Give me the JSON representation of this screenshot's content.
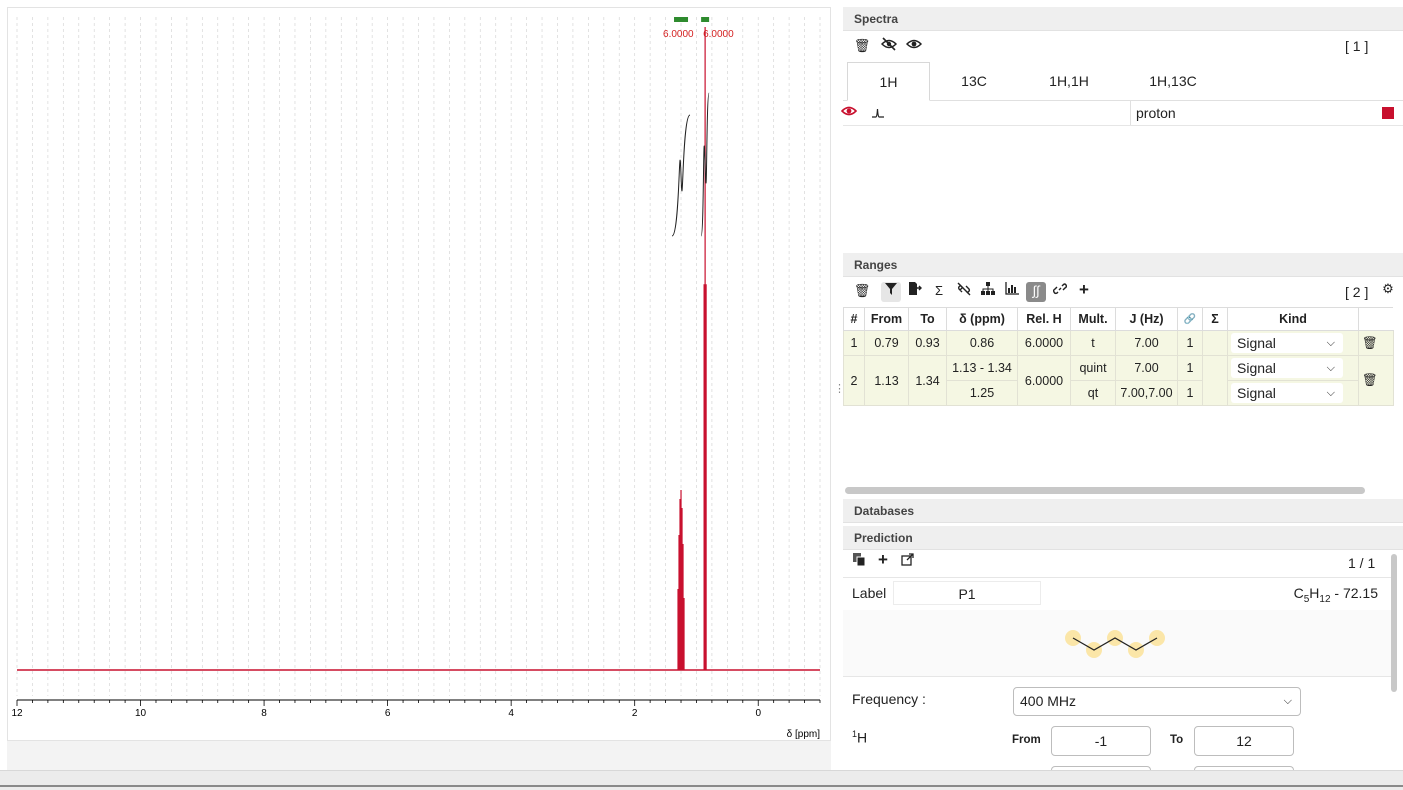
{
  "colors": {
    "spectrum": "#c8102e",
    "integral": "#222222",
    "range_marker": "#2e8b2e",
    "range_label": "#d42222",
    "row_bg": "#f5f7e3"
  },
  "chart_data": {
    "type": "line",
    "xlabel": "δ [ppm]",
    "xlim": [
      12,
      -1
    ],
    "x_ticks": [
      "12",
      "10",
      "8",
      "6",
      "4",
      "2",
      "0"
    ],
    "x_tick_values": [
      12,
      10,
      8,
      6,
      4,
      2,
      0
    ],
    "peaks": [
      {
        "ppm": 1.25,
        "height": 0.28
      },
      {
        "ppm": 0.86,
        "height": 1.0
      }
    ],
    "integral_labels": [
      "6.0000",
      "6.0000"
    ],
    "grid": "vertical dashed"
  },
  "spectra": {
    "title": "Spectra",
    "count": "[ 1 ]",
    "icons": [
      "trash-icon",
      "hide-all-icon",
      "show-all-icon"
    ],
    "tabs": [
      {
        "label": "1H",
        "active": true
      },
      {
        "label": "13C",
        "active": false
      },
      {
        "label": "1H,1H",
        "active": false
      },
      {
        "label": "1H,13C",
        "active": false
      }
    ],
    "row": {
      "name": "proton",
      "color": "#c8102e"
    }
  },
  "ranges": {
    "title": "Ranges",
    "count": "[ 2 ]",
    "columns": [
      "#",
      "From",
      "To",
      "δ (ppm)",
      "Rel. H",
      "Mult.",
      "J (Hz)",
      "🔗",
      "Σ",
      "Kind"
    ],
    "rows": [
      {
        "index": "1",
        "from": "0.79",
        "to": "0.93",
        "delta": "0.86",
        "rel_h": "6.0000",
        "mult": "t",
        "j": "7.00",
        "link": "1",
        "kind": "Signal"
      },
      {
        "index": "2",
        "from": "1.13",
        "to": "1.34",
        "delta": "1.13 - 1.34",
        "rel_h": "6.0000",
        "mult": "quint",
        "j": "7.00",
        "link": "1",
        "kind": "Signal",
        "sub": {
          "delta": "1.25",
          "mult": "qt",
          "j": "7.00,7.00",
          "link": "1",
          "kind": "Signal"
        }
      }
    ]
  },
  "databases": {
    "title": "Databases"
  },
  "prediction": {
    "title": "Prediction",
    "page": "1 / 1",
    "label_caption": "Label",
    "label_value": "P1",
    "formula": "C",
    "formula_c": "5",
    "formula_h": "H",
    "formula_hn": "12",
    "formula_mass": " - 72.15",
    "frequency_label": "Frequency :",
    "frequency_value": "400 MHz",
    "nucleus_sup": "1",
    "nucleus": "H",
    "from_label": "From",
    "from_value": "-1",
    "to_label": "To",
    "to_value": "12"
  }
}
